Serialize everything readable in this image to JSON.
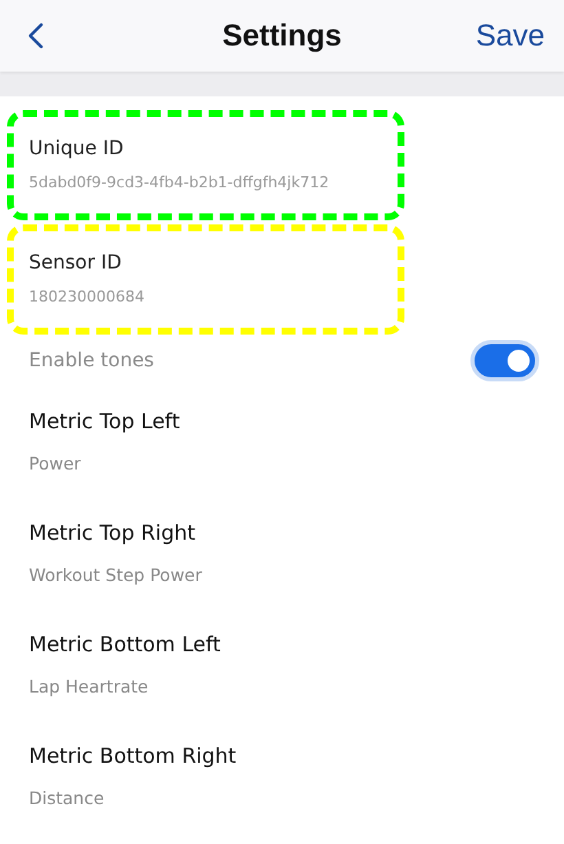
{
  "header": {
    "title": "Settings",
    "save": "Save"
  },
  "id_fields": [
    {
      "label": "Unique ID",
      "value": "5dabd0f9-9cd3-4fb4-b2b1-dffgfh4jk712",
      "color": "#00ff00"
    },
    {
      "label": "Sensor ID",
      "value": "180230000684",
      "color": "#ffff00"
    }
  ],
  "toggle": {
    "label": "Enable tones",
    "on": true
  },
  "metrics": [
    {
      "label": "Metric Top Left",
      "value": "Power"
    },
    {
      "label": "Metric Top Right",
      "value": "Workout Step Power"
    },
    {
      "label": "Metric Bottom Left",
      "value": "Lap Heartrate"
    },
    {
      "label": "Metric Bottom Right",
      "value": "Distance"
    }
  ]
}
